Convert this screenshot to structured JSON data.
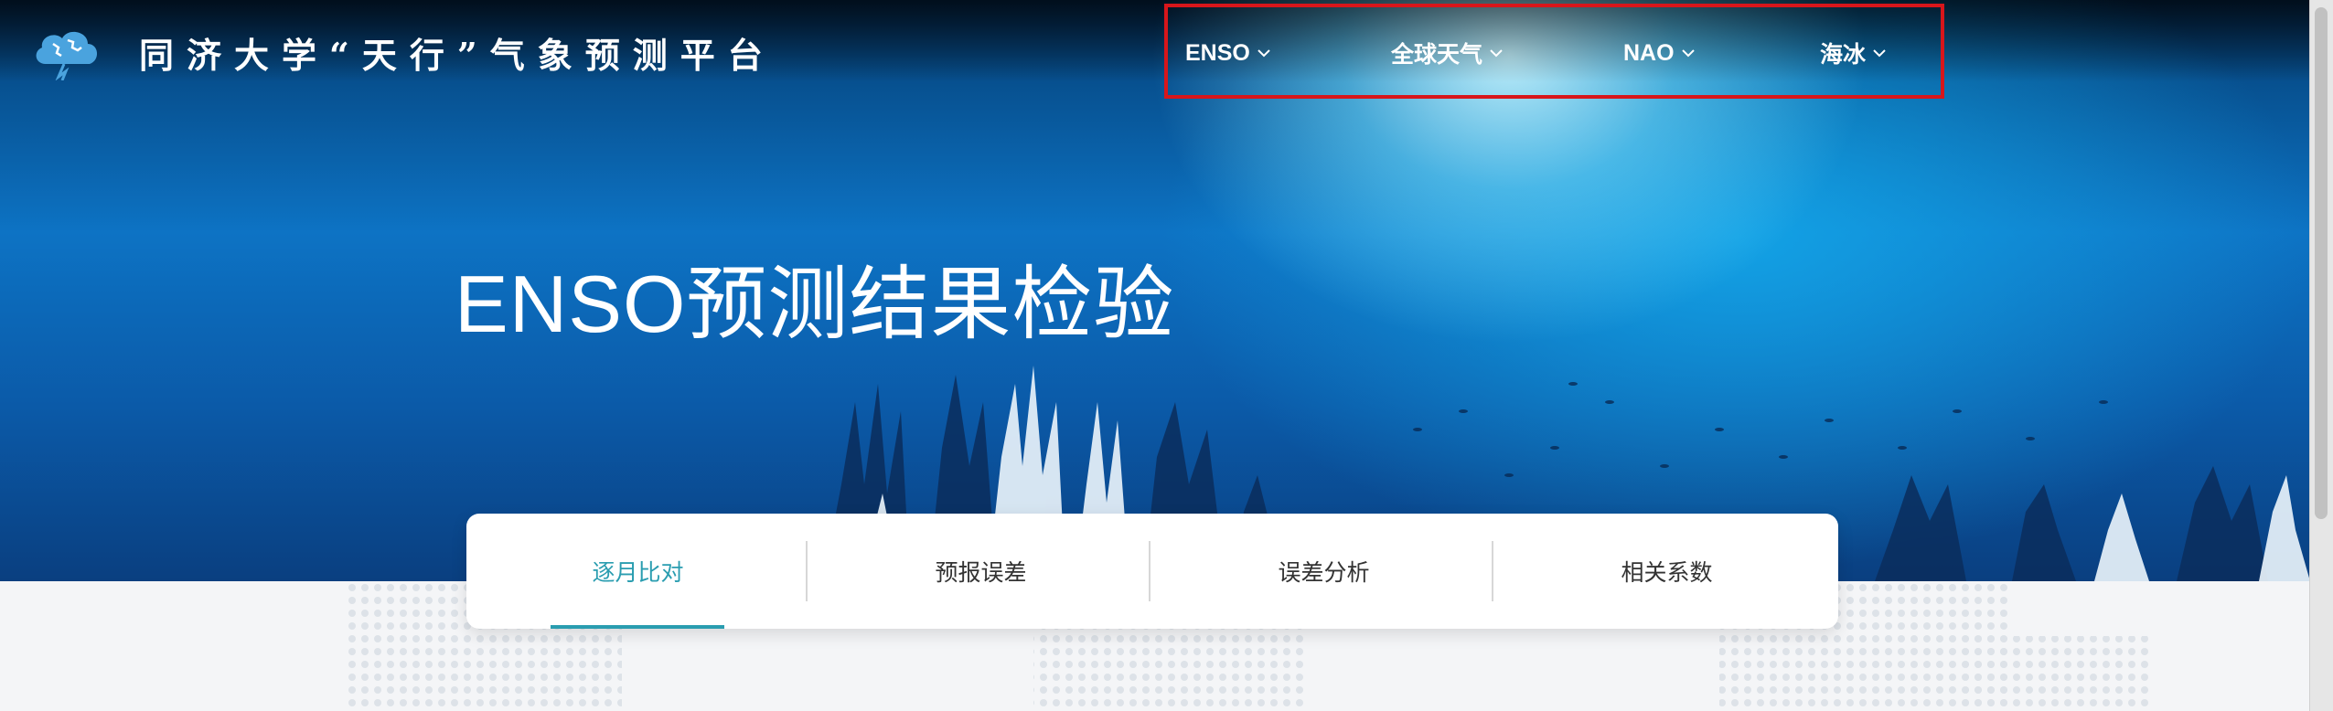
{
  "header": {
    "site_title": "同济大学“天行”气象预测平台",
    "logo_icon": "cloud-globe-lightning-icon"
  },
  "nav": {
    "items": [
      {
        "label": "ENSO",
        "icon": "chevron-down-icon"
      },
      {
        "label": "全球天气",
        "icon": "chevron-down-icon"
      },
      {
        "label": "NAO",
        "icon": "chevron-down-icon"
      },
      {
        "label": "海冰",
        "icon": "chevron-down-icon"
      }
    ],
    "highlight_color": "#d8161b"
  },
  "hero": {
    "heading": "ENSO预测结果检验"
  },
  "tabs": {
    "items": [
      {
        "label": "逐月比对",
        "active": true
      },
      {
        "label": "预报误差",
        "active": false
      },
      {
        "label": "误差分析",
        "active": false
      },
      {
        "label": "相关系数",
        "active": false
      }
    ],
    "active_color": "#2a9db0"
  }
}
